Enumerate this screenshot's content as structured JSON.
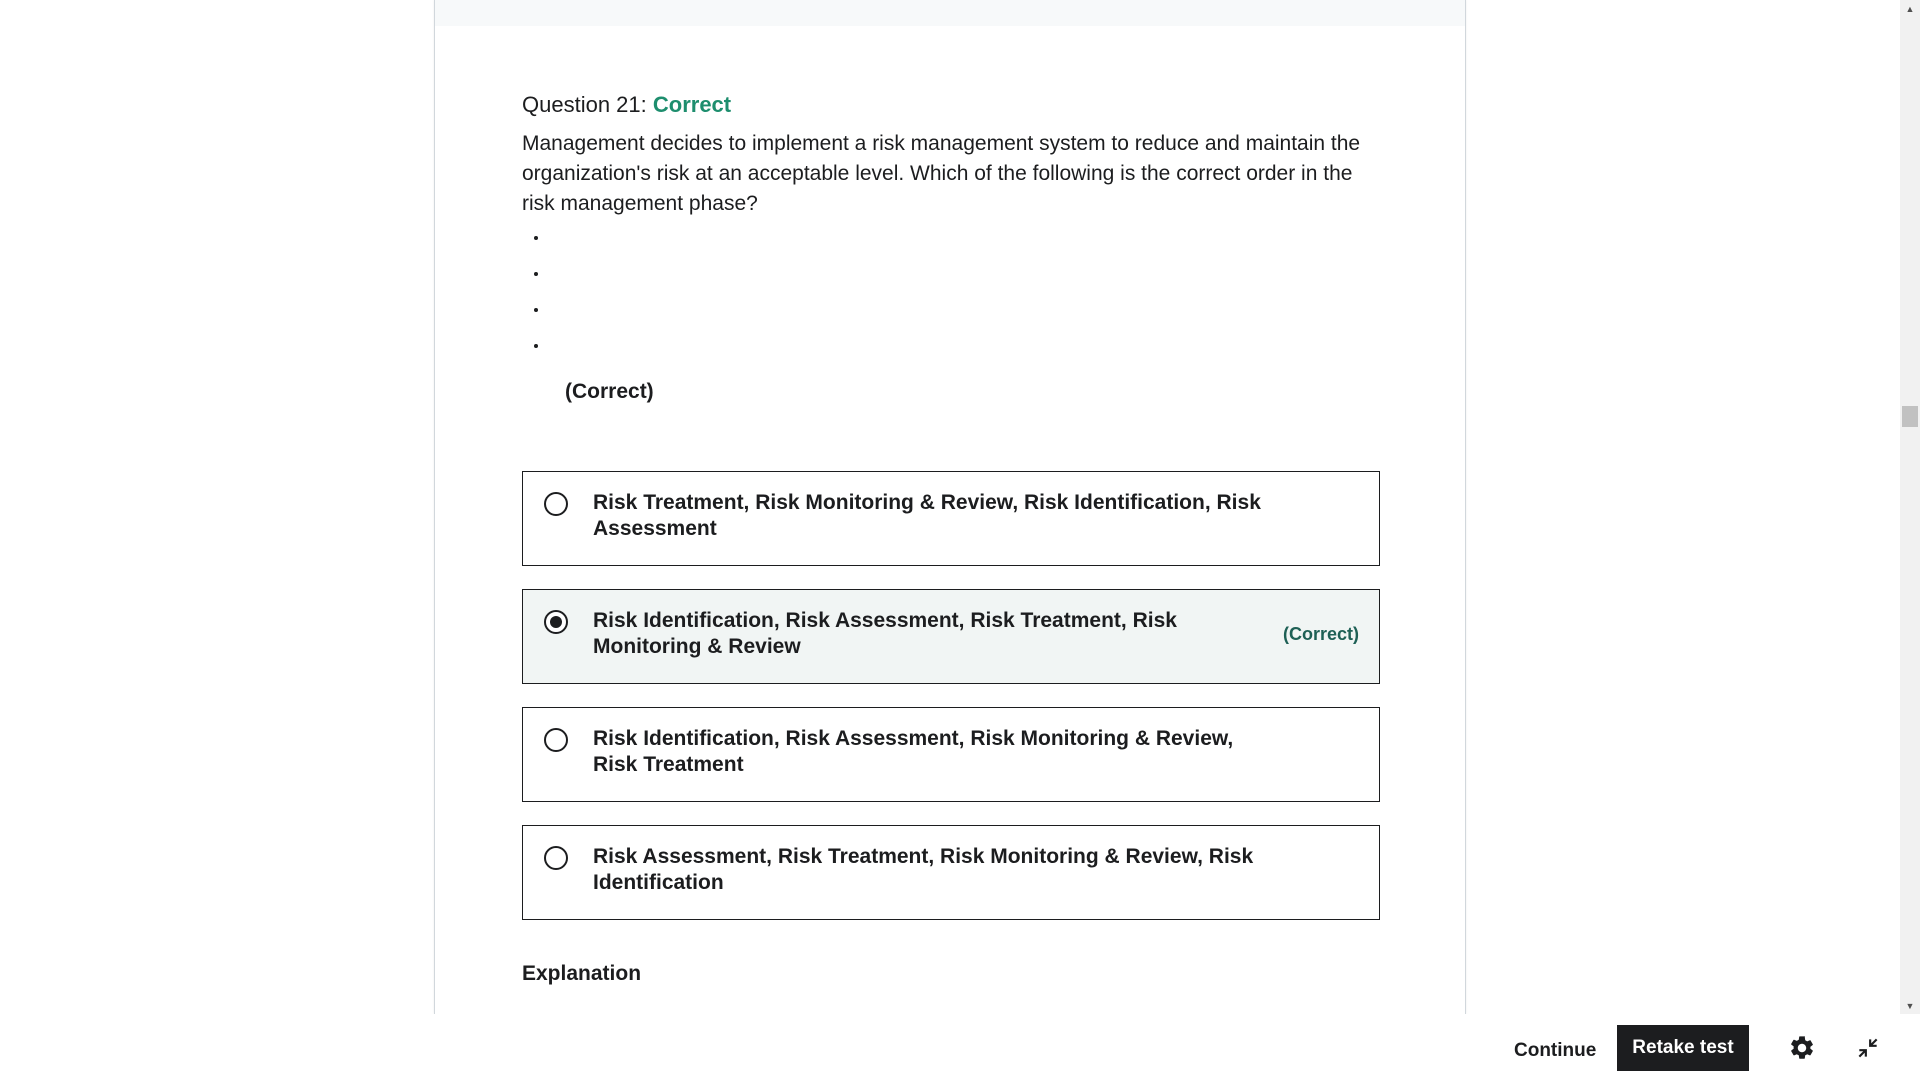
{
  "question": {
    "heading_prefix": "Question 21: ",
    "result": "Correct",
    "text": "Management decides to implement a risk management system to reduce and maintain the organization's risk at an acceptable level. Which of the following is the correct order in the risk management phase?",
    "correct_note": "(Correct)"
  },
  "options": [
    {
      "label": "Risk Treatment, Risk Monitoring & Review, Risk Identification, Risk Assessment",
      "selected": false,
      "tag": ""
    },
    {
      "label": "Risk Identification, Risk Assessment, Risk Treatment, Risk Monitoring & Review",
      "selected": true,
      "tag": "(Correct)"
    },
    {
      "label": "Risk Identification, Risk Assessment, Risk Monitoring & Review, Risk Treatment",
      "selected": false,
      "tag": ""
    },
    {
      "label": "Risk Assessment, Risk Treatment, Risk Monitoring & Review, Risk Identification",
      "selected": false,
      "tag": ""
    }
  ],
  "explanation": {
    "title": "Explanation"
  },
  "footer": {
    "continue_label": "Continue",
    "retake_label": "Retake test",
    "settings_icon": "gear-icon",
    "collapse_icon": "collapse-icon"
  },
  "colors": {
    "correct": "#1e8e6e",
    "selected_bg": "#f1f5f4"
  }
}
